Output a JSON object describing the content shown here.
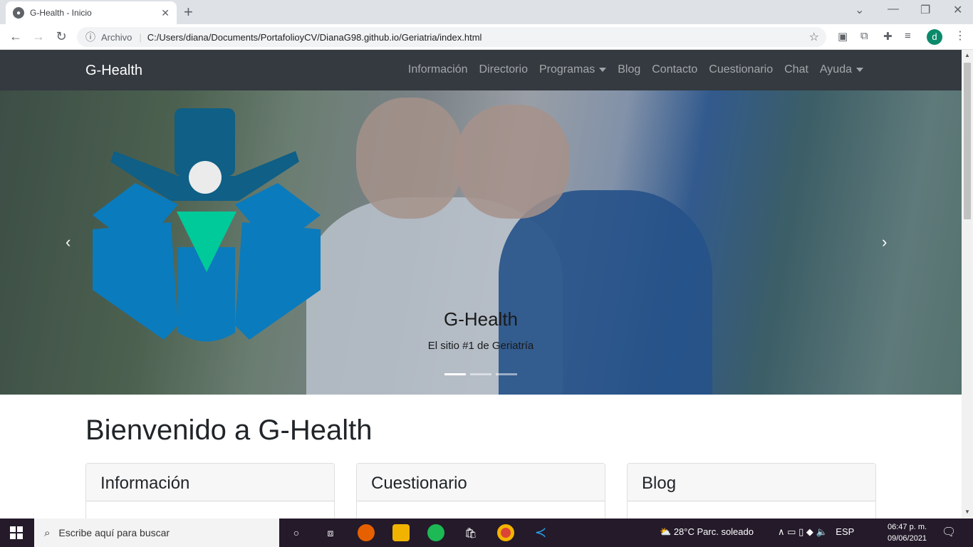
{
  "browser": {
    "tab_title": "G-Health - Inicio",
    "new_tab_icon": "plus-icon",
    "address_security": "Archivo",
    "address_url": "C:/Users/diana/Documents/PortafolioyCV/DianaG98.github.io/Geriatria/index.html",
    "profile_initial": "d"
  },
  "navbar": {
    "brand": "G-Health",
    "links": [
      "Información",
      "Directorio",
      "Programas",
      "Blog",
      "Contacto",
      "Cuestionario",
      "Chat",
      "Ayuda"
    ]
  },
  "carousel": {
    "caption_title": "G-Health",
    "caption_text": "El sitio #1 de Geriatría",
    "indicator_count": 3,
    "active_indicator": 1,
    "logo_colors": {
      "dark_blue": "#0f5f86",
      "blue": "#0a7bbd",
      "green": "#00c99a",
      "circle": "#ebebeb"
    }
  },
  "main": {
    "welcome": "Bienvenido a G-Health",
    "cards": [
      {
        "title": "Información"
      },
      {
        "title": "Cuestionario"
      },
      {
        "title": "Blog"
      }
    ]
  },
  "taskbar": {
    "search_placeholder": "Escribe aquí para buscar",
    "weather_temp": "28°C",
    "weather_desc": "Parc. soleado",
    "language": "ESP",
    "time": "06:47 p. m.",
    "date": "09/06/2021"
  }
}
